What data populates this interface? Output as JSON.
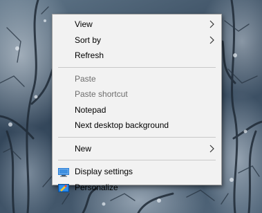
{
  "desktop": {
    "background": "snow-covered-trees-wallpaper"
  },
  "context_menu": {
    "group1": [
      {
        "label": "View",
        "submenu": true,
        "enabled": true
      },
      {
        "label": "Sort by",
        "submenu": true,
        "enabled": true
      },
      {
        "label": "Refresh",
        "submenu": false,
        "enabled": true
      }
    ],
    "group2": [
      {
        "label": "Paste",
        "submenu": false,
        "enabled": false
      },
      {
        "label": "Paste shortcut",
        "submenu": false,
        "enabled": false
      },
      {
        "label": "Notepad",
        "submenu": false,
        "enabled": true
      },
      {
        "label": "Next desktop background",
        "submenu": false,
        "enabled": true
      }
    ],
    "group3": [
      {
        "label": "New",
        "submenu": true,
        "enabled": true
      }
    ],
    "group4": [
      {
        "label": "Display settings",
        "icon": "display-icon",
        "enabled": true
      },
      {
        "label": "Personalize",
        "icon": "personalize-icon",
        "enabled": true
      }
    ]
  },
  "colors": {
    "menu_background": "#f2f2f2",
    "menu_border": "#a0a0a0",
    "disabled_text": "#6d6d6d",
    "separator": "#c8c8c8",
    "icon_blue": "#1e78d7"
  }
}
